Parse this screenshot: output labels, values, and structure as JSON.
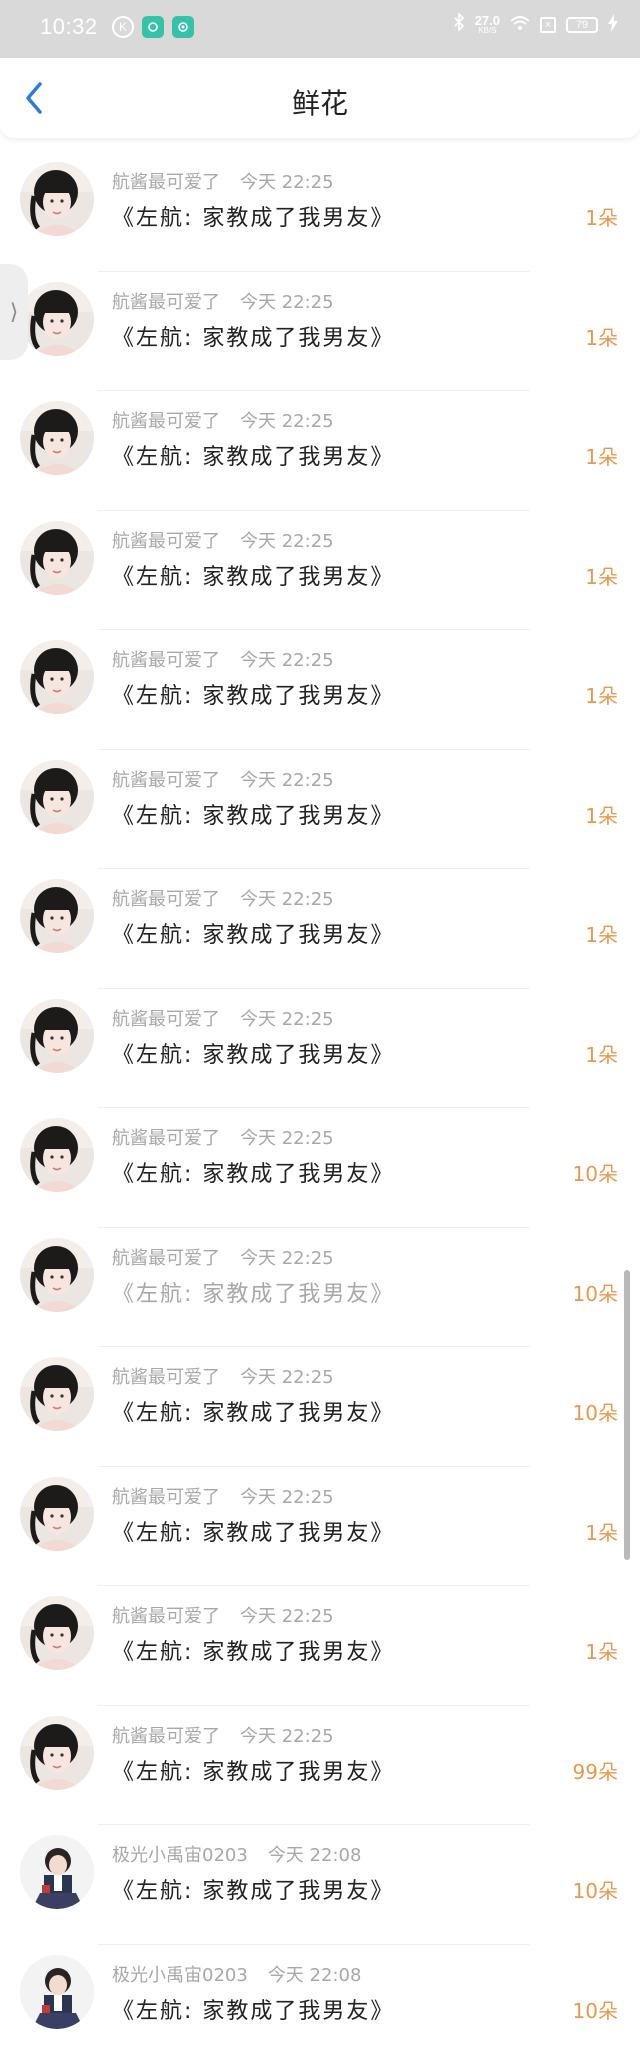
{
  "status_bar": {
    "time": "10:32",
    "icons_left": [
      "k-icon",
      "message-icon",
      "camera-icon"
    ],
    "net_speed_value": "27.0",
    "net_speed_unit": "KB/S",
    "battery": "79",
    "icons_right": [
      "bluetooth-icon",
      "wifi-icon",
      "sim-x-icon",
      "battery-icon",
      "charging-icon"
    ]
  },
  "header": {
    "title": "鲜花",
    "back_icon": "chevron-left-icon"
  },
  "colors": {
    "accent": "#2f7bd9",
    "count": "#e8994f",
    "meta": "#a8a8a8"
  },
  "items": [
    {
      "name": "航酱最可爱了",
      "time": "今天 22:25",
      "message": "《左航: 家教成了我男友》",
      "count": "1朵"
    },
    {
      "name": "航酱最可爱了",
      "time": "今天 22:25",
      "message": "《左航: 家教成了我男友》",
      "count": "1朵"
    },
    {
      "name": "航酱最可爱了",
      "time": "今天 22:25",
      "message": "《左航: 家教成了我男友》",
      "count": "1朵"
    },
    {
      "name": "航酱最可爱了",
      "time": "今天 22:25",
      "message": "《左航: 家教成了我男友》",
      "count": "1朵"
    },
    {
      "name": "航酱最可爱了",
      "time": "今天 22:25",
      "message": "《左航: 家教成了我男友》",
      "count": "1朵"
    },
    {
      "name": "航酱最可爱了",
      "time": "今天 22:25",
      "message": "《左航: 家教成了我男友》",
      "count": "1朵"
    },
    {
      "name": "航酱最可爱了",
      "time": "今天 22:25",
      "message": "《左航: 家教成了我男友》",
      "count": "1朵"
    },
    {
      "name": "航酱最可爱了",
      "time": "今天 22:25",
      "message": "《左航: 家教成了我男友》",
      "count": "1朵"
    },
    {
      "name": "航酱最可爱了",
      "time": "今天 22:25",
      "message": "《左航: 家教成了我男友》",
      "count": "10朵"
    },
    {
      "name": "航酱最可爱了",
      "time": "今天 22:25",
      "message": "《左航: 家教成了我男友》",
      "count": "10朵"
    },
    {
      "name": "航酱最可爱了",
      "time": "今天 22:25",
      "message": "《左航: 家教成了我男友》",
      "count": "10朵"
    },
    {
      "name": "航酱最可爱了",
      "time": "今天 22:25",
      "message": "《左航: 家教成了我男友》",
      "count": "1朵"
    },
    {
      "name": "航酱最可爱了",
      "time": "今天 22:25",
      "message": "《左航: 家教成了我男友》",
      "count": "1朵"
    },
    {
      "name": "航酱最可爱了",
      "time": "今天 22:25",
      "message": "《左航: 家教成了我男友》",
      "count": "99朵"
    },
    {
      "name": "极光小禹宙0203",
      "time": "今天 22:08",
      "message": "《左航: 家教成了我男友》",
      "count": "10朵"
    },
    {
      "name": "极光小禹宙0203",
      "time": "今天 22:08",
      "message": "《左航: 家教成了我男友》",
      "count": "10朵"
    }
  ]
}
